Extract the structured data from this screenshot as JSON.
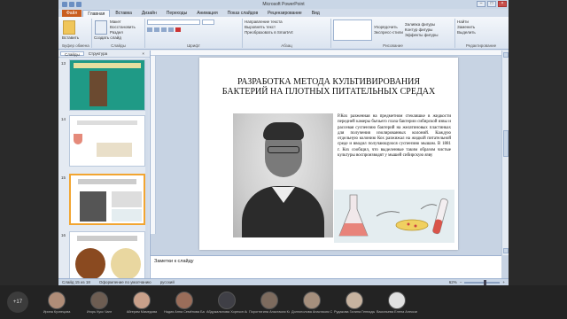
{
  "window": {
    "title": "Microsoft PowerPoint"
  },
  "tabs": [
    "Файл",
    "Главная",
    "Вставка",
    "Дизайн",
    "Переходы",
    "Анимация",
    "Показ слайдов",
    "Рецензирование",
    "Вид"
  ],
  "ribbon": {
    "groups": [
      "Буфер обмена",
      "Слайды",
      "Шрифт",
      "Абзац",
      "Рисование",
      "Редактирование"
    ],
    "paste_label": "Вставить",
    "new_slide_label": "Создать слайд",
    "items": [
      "Макет",
      "Восстановить",
      "Раздел",
      "Направление текста",
      "Выровнять текст",
      "Преобразовать в SmartArt",
      "Упорядочить",
      "Экспресс-стили",
      "Заливка фигуры",
      "Контур фигуры",
      "Эффекты фигуры",
      "Найти",
      "Заменить",
      "Выделить"
    ]
  },
  "panel": {
    "tab_slides": "Слайды",
    "tab_outline": "Структура",
    "close": "×"
  },
  "thumbnails": [
    {
      "number": "13"
    },
    {
      "number": "14"
    },
    {
      "number": "15"
    },
    {
      "number": "16"
    }
  ],
  "slide": {
    "title_line1": "РАЗРАБОТКА МЕТОДА КУЛЬТИВИРОВАНИЯ",
    "title_line2": "БАКТЕРИЙ НА ПЛОТНЫХ ПИТАТЕЛЬНЫХ СРЕДАХ",
    "body": "Р.Кох разженная на предметном стекляшке в жидкости передней камеры бычьего глаза бактерии сибирской язвы и рассевая суспензию бактерий на желатиновых пластинках для получения изолированных колоний. Каждую отдельную колонию Кох разжижал на жидкой питательной среде и вводил получающуюся суспензию мышам. В 1881 г. Кох сообщил, что выделенные таким образом чистые культуры воспроизводят у мышей сибирскую язву"
  },
  "notes_placeholder": "Заметки к слайду",
  "status": {
    "slide_info": "Слайд 15 из 18",
    "theme": "Оформление по умолчанию",
    "language": "русский",
    "zoom": "62%"
  },
  "meeting": {
    "participant_count": "+17",
    "participants": [
      {
        "name": "Ирина Кузнецова"
      },
      {
        "name": "Игорь Кукс Чанг"
      },
      {
        "name": "Айгерим Мамедова"
      },
      {
        "name": "Надия Анна Семёнова Баженова"
      },
      {
        "name": "Абдужалилова Хорезон Асатуллаевна"
      },
      {
        "name": "Порогтигина Анастасия Константиновна"
      },
      {
        "name": "Долгополова Анастасия Сергеевна"
      },
      {
        "name": "Рудакова Галина Геннадьевна"
      },
      {
        "name": "Васильева Елена Александровна"
      }
    ]
  },
  "colors": {
    "accent": "#c95d1f",
    "selection": "#f2a531"
  }
}
